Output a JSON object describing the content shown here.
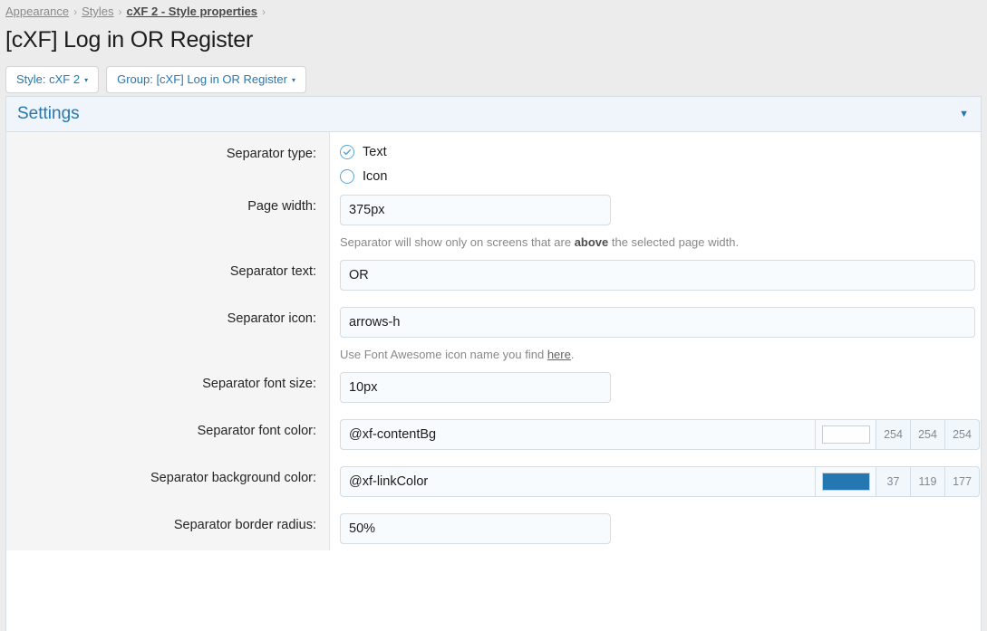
{
  "breadcrumb": {
    "items": [
      {
        "label": "Appearance",
        "style": "plain"
      },
      {
        "label": "Styles",
        "style": "plain"
      },
      {
        "label": "cXF 2 - Style properties",
        "style": "strong"
      }
    ],
    "separator": "›"
  },
  "page_title": "[cXF] Log in OR Register",
  "toolbar": {
    "style_button": "Style: cXF 2",
    "group_button": "Group: [cXF] Log in OR Register",
    "caret_glyph": "▾"
  },
  "panel": {
    "title": "Settings",
    "chevron_glyph": "▼",
    "accent_color": "#2577b1",
    "header_bg": "#eff5fb"
  },
  "form": {
    "separator_type": {
      "label": "Separator type:",
      "options": [
        {
          "label": "Text",
          "checked": true
        },
        {
          "label": "Icon",
          "checked": false
        }
      ]
    },
    "page_width": {
      "label": "Page width:",
      "value": "375px",
      "hint_before": "Separator will show only on screens that are ",
      "hint_bold": "above",
      "hint_after": " the selected page width."
    },
    "separator_text": {
      "label": "Separator text:",
      "value": "OR"
    },
    "separator_icon": {
      "label": "Separator icon:",
      "value": "arrows-h",
      "hint_before": "Use Font Awesome icon name you find ",
      "hint_link": "here",
      "hint_after": "."
    },
    "separator_font_size": {
      "label": "Separator font size:",
      "value": "10px"
    },
    "separator_font_color": {
      "label": "Separator font color:",
      "value": "@xf-contentBg",
      "swatch": "#fefefe",
      "r": "254",
      "g": "254",
      "b": "254"
    },
    "separator_background_color": {
      "label": "Separator background color:",
      "value": "@xf-linkColor",
      "swatch": "#2577b1",
      "r": "37",
      "g": "119",
      "b": "177"
    },
    "separator_border_radius": {
      "label": "Separator border radius:",
      "value": "50%"
    }
  }
}
